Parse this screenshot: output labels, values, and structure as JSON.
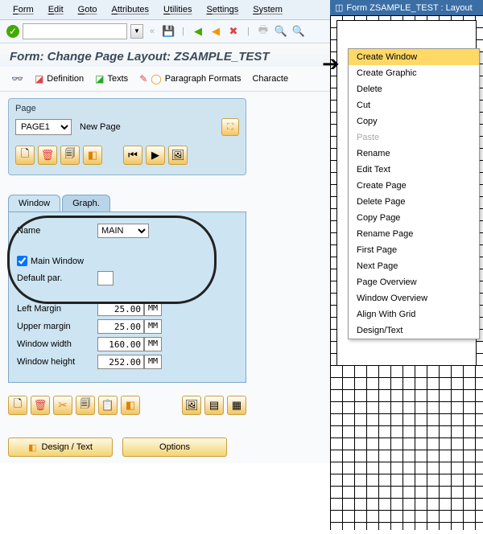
{
  "menubar": {
    "items": [
      "Form",
      "Edit",
      "Goto",
      "Attributes",
      "Utilities",
      "Settings",
      "System"
    ]
  },
  "title": "Form: Change Page Layout: ZSAMPLE_TEST",
  "toolbar2": {
    "definition": "Definition",
    "texts": "Texts",
    "paragraph": "Paragraph Formats",
    "character": "Characte"
  },
  "page_panel": {
    "label": "Page",
    "page_value": "PAGE1",
    "new_page": "New Page"
  },
  "tabs": {
    "window": "Window",
    "graph": "Graph."
  },
  "window_panel": {
    "name_label": "Name",
    "name_value": "MAIN",
    "main_window_label": "Main Window",
    "main_window_checked": true,
    "default_par_label": "Default par.",
    "left_margin_label": "Left Margin",
    "left_margin_value": "25.00",
    "upper_margin_label": "Upper margin",
    "upper_margin_value": "25.00",
    "window_width_label": "Window width",
    "window_width_value": "160.00",
    "window_height_label": "Window height",
    "window_height_value": "252.00",
    "unit": "MM"
  },
  "footer": {
    "design_text": "Design / Text",
    "options": "Options"
  },
  "form_window": {
    "title": "Form ZSAMPLE_TEST : Layout"
  },
  "context_menu": {
    "items": [
      {
        "label": "Create Window",
        "hl": true
      },
      {
        "label": "Create Graphic"
      },
      {
        "label": "Delete"
      },
      {
        "label": "Cut"
      },
      {
        "label": "Copy"
      },
      {
        "label": "Paste",
        "disabled": true
      },
      {
        "label": "Rename"
      },
      {
        "label": "Edit Text"
      },
      {
        "label": "Create Page"
      },
      {
        "label": "Delete Page"
      },
      {
        "label": "Copy Page"
      },
      {
        "label": "Rename Page"
      },
      {
        "label": "First Page"
      },
      {
        "label": "Next Page"
      },
      {
        "label": "Page Overview"
      },
      {
        "label": "Window Overview"
      },
      {
        "label": "Align With Grid"
      },
      {
        "label": "Design/Text"
      }
    ]
  }
}
